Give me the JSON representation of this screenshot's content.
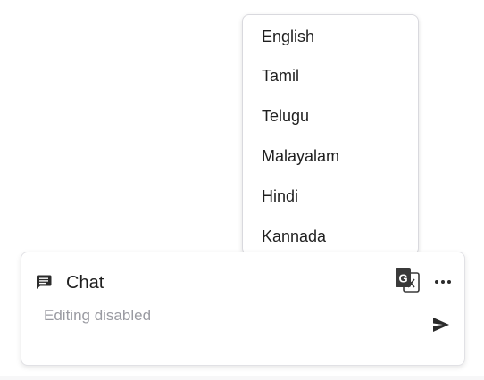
{
  "language_menu": {
    "items": [
      {
        "label": "English"
      },
      {
        "label": "Tamil"
      },
      {
        "label": "Telugu"
      },
      {
        "label": "Malayalam"
      },
      {
        "label": "Hindi"
      },
      {
        "label": "Kannada"
      }
    ]
  },
  "chat": {
    "title": "Chat",
    "input_placeholder": "Editing disabled",
    "icons": {
      "chat": "chat-bubble-icon",
      "translate": "translate-icon",
      "more": "more-horizontal-icon",
      "send": "send-icon"
    }
  },
  "colors": {
    "text": "#1f1f1f",
    "placeholder": "#9a9ba2",
    "icon": "#2b2b2b",
    "border": "#d9d9de"
  }
}
